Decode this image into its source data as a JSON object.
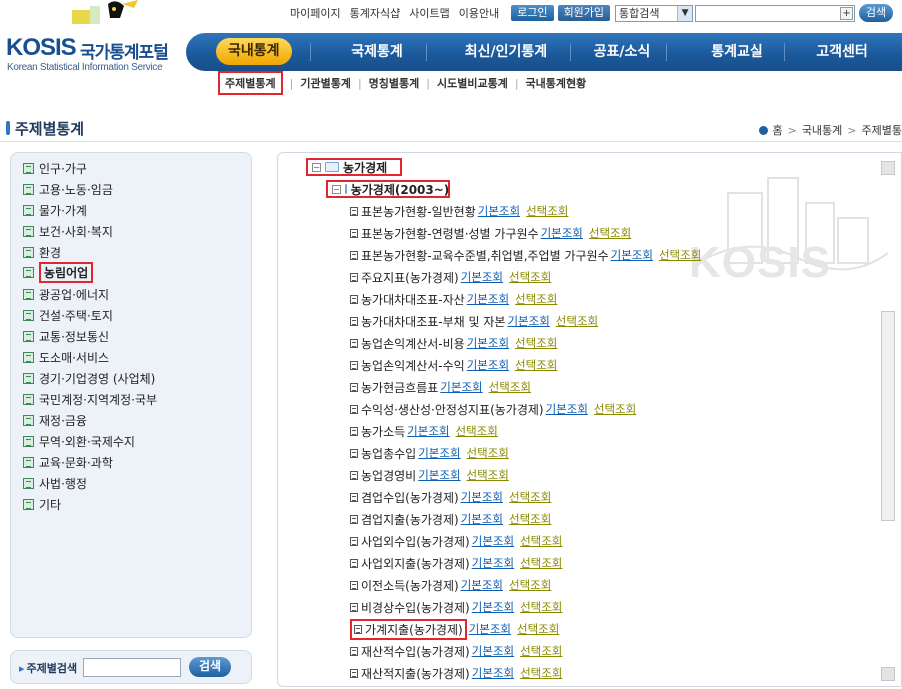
{
  "header": {
    "logo_text": "KOSIS",
    "logo_text_ko": "국가통계포털",
    "logo_sub": "Korean Statistical Information Service",
    "util_links": [
      "마이페이지",
      "통계자식샵",
      "사이트맵",
      "이용안내"
    ],
    "login_label": "로그인",
    "join_label": "회원가입",
    "search_scope": "통합검색",
    "search_button": "검색"
  },
  "gnb": {
    "items": [
      "국내통계",
      "국제통계",
      "최신/인기통계",
      "공표/소식",
      "통계교실",
      "고객센터"
    ],
    "active": "국내통계"
  },
  "lnb": {
    "items": [
      "주제별통계",
      "기관별통계",
      "명칭별통계",
      "시도별비교통계",
      "국내통계현황"
    ]
  },
  "page": {
    "title": "주제별통계",
    "breadcrumb": [
      "홈",
      "국내통계",
      "주제별통"
    ]
  },
  "sidebar": {
    "categories": [
      "인구·가구",
      "고용·노동·임금",
      "물가·가계",
      "보건·사회·복지",
      "환경",
      "농림어업",
      "광공업·에너지",
      "건설·주택·토지",
      "교통·정보통신",
      "도소매·서비스",
      "경기·기업경영 (사업체)",
      "국민계정·지역계정·국부",
      "재정·금융",
      "무역·외환·국제수지",
      "교육·문화·과학",
      "사법·행정",
      "기타"
    ],
    "selected": "농림어업",
    "search_label": "주제별검색",
    "search_button": "검색"
  },
  "tree": {
    "root": "농가경제",
    "child": "농가경제(2003~)",
    "basic_label": "기본조회",
    "choice_label": "선택조회",
    "watermark": "KOSIS",
    "leaves": [
      "표본농가현황-일반현황",
      "표본농가현황-연령별·성별 가구원수",
      "표본농가현황-교육수준별,취업별,주업별 가구원수",
      "주요지표(농가경제)",
      "농가대차대조표-자산",
      "농가대차대조표-부채 및 자본",
      "농업손익계산서-비용",
      "농업손익계산서-수익",
      "농가현금흐름표",
      "수익성·생산성·안정성지표(농가경제)",
      "농가소득",
      "농업총수입",
      "농업경영비",
      "겸업수입(농가경제)",
      "겸업지출(농가경제)",
      "사업외수입(농가경제)",
      "사업외지출(농가경제)",
      "이전소득(농가경제)",
      "비경상수입(농가경제)",
      "가계지출(농가경제)",
      "재산적수입(농가경제)",
      "재산적지출(농가경제)"
    ],
    "highlighted_leaf": "가계지출(농가경제)"
  }
}
